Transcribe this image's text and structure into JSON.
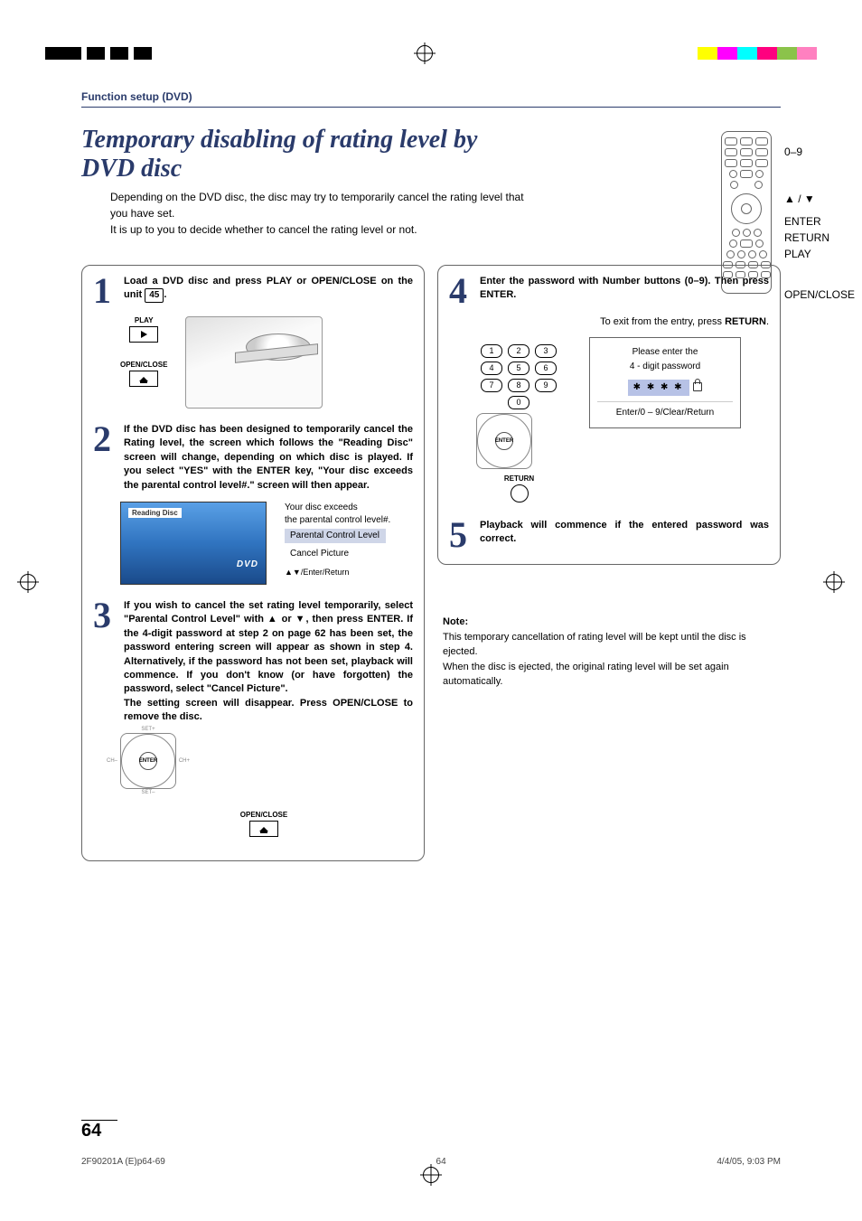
{
  "header": {
    "section": "Function setup (DVD)"
  },
  "title": "Temporary disabling of rating level by DVD disc",
  "subtitle": "Depending on the DVD disc, the disc may try to temporarily cancel the rating level that you have set.\nIt is up to you to decide whether to cancel the rating level or not.",
  "remote_labels": {
    "nums": "0–9",
    "arrows": "▲ / ▼",
    "enter": "ENTER",
    "return": "RETURN",
    "play": "PLAY",
    "openclose": "OPEN/CLOSE"
  },
  "steps": [
    {
      "num": "1",
      "text_prefix": "Load a DVD disc and press PLAY or OPEN/CLOSE on the unit ",
      "ref": "45",
      "text_suffix": ".",
      "play_label": "PLAY",
      "openclose_label": "OPEN/CLOSE"
    },
    {
      "num": "2",
      "text": "If the DVD disc has been designed to temporarily cancel the Rating level, the screen which follows the \"Reading Disc\" screen will change, depending on which disc is played. If you select \"YES\" with the ENTER key, \"Your disc exceeds the parental control level#.\" screen will then appear.",
      "reading_disc": "Reading Disc",
      "dvd_logo": "DVD",
      "panel_line1": "Your disc exceeds",
      "panel_line2": "the parental control level#.",
      "menu_parental": "Parental Control Level",
      "menu_cancel": "Cancel Picture",
      "panel_hint": "▲▼/Enter/Return"
    },
    {
      "num": "3",
      "text": "If you wish to cancel the set rating level temporarily, select \"Parental Control Level\" with ▲ or ▼, then press ENTER. If the 4-digit password at step 2 on page 62 has been set, the password entering screen will appear as shown in step 4. Alternatively, if the password has not been set, playback will commence. If you don't know (or have forgotten) the password, select \"Cancel Picture\".\nThe setting screen will disappear. Press OPEN/CLOSE to remove the disc.",
      "enter_center": "ENTER",
      "ch_minus": "CH–",
      "ch_plus": "CH+",
      "set_plus": "SET+",
      "set_minus": "SET–",
      "openclose_label": "OPEN/CLOSE"
    },
    {
      "num": "4",
      "text": "Enter the password with Number buttons (0–9). Then press ENTER.",
      "exit_prefix": "To exit from the entry, press ",
      "exit_bold": "RETURN",
      "exit_suffix": ".",
      "numbers": [
        "1",
        "2",
        "3",
        "4",
        "5",
        "6",
        "7",
        "8",
        "9",
        "0"
      ],
      "enter_center": "ENTER",
      "return_label": "RETURN",
      "pw_line1": "Please enter the",
      "pw_line2": "4 - digit password",
      "pw_mask": "✱ ✱ ✱ ✱",
      "pw_hint": "Enter/0 – 9/Clear/Return"
    },
    {
      "num": "5",
      "text": "Playback will commence if the entered password was correct."
    }
  ],
  "note": {
    "label": "Note:",
    "line1": "This temporary cancellation of rating level will be kept until the disc is ejected.",
    "line2": "When the disc is ejected, the original rating level will be set again automatically."
  },
  "page_number": "64",
  "footer": {
    "left": "2F90201A (E)p64-69",
    "center": "64",
    "right": "4/4/05, 9:03 PM"
  }
}
